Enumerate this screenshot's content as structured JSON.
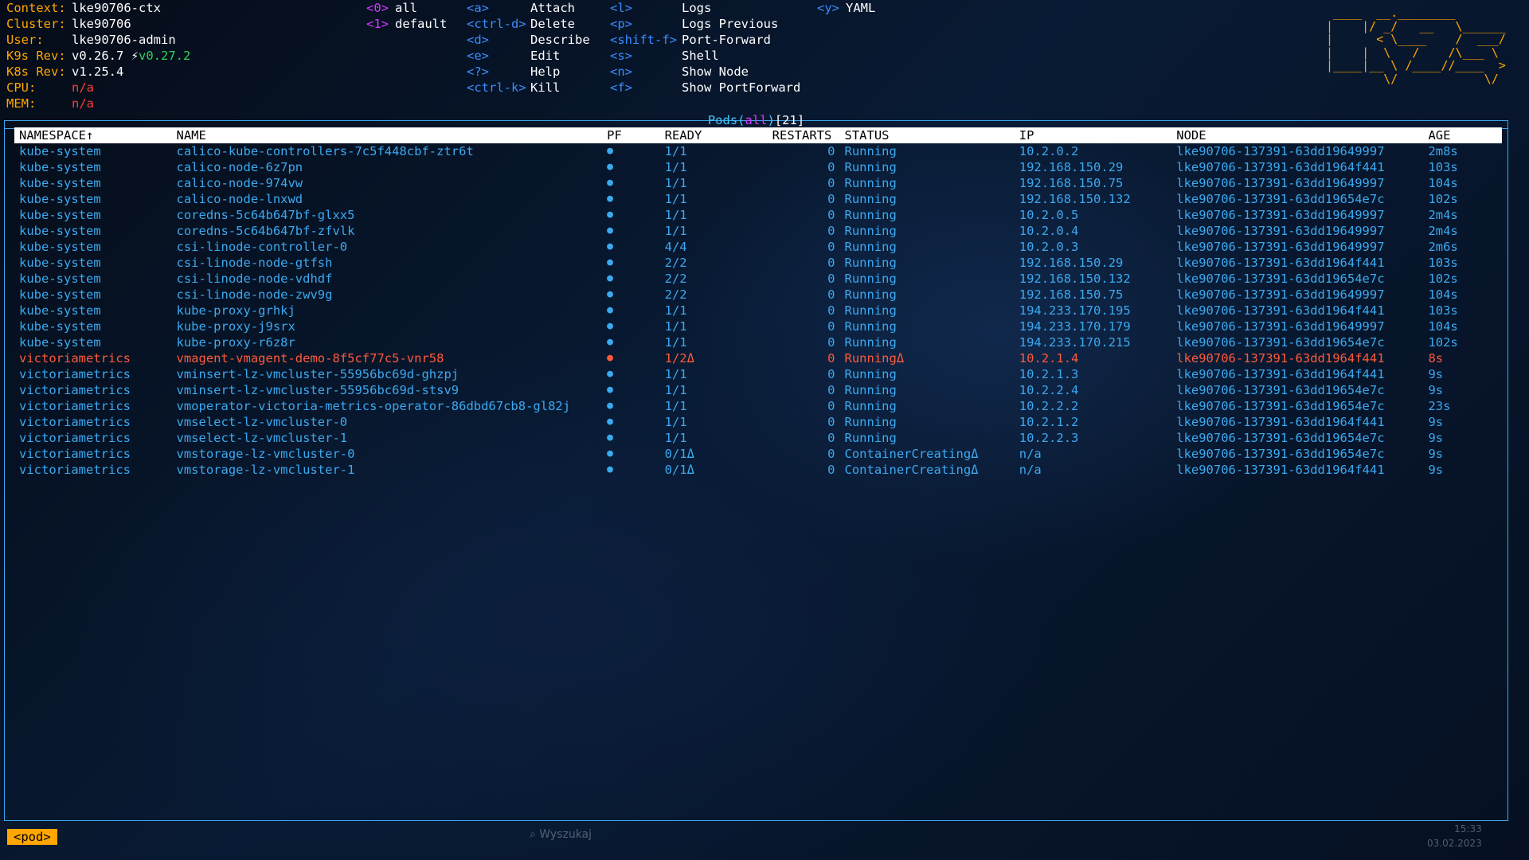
{
  "context_info": [
    {
      "label": "Context:",
      "value": "lke90706-ctx"
    },
    {
      "label": "Cluster:",
      "value": "lke90706"
    },
    {
      "label": "User:",
      "value": "lke90706-admin"
    },
    {
      "label": "K9s Rev:",
      "value": "v0.26.7",
      "update": "v0.27.2"
    },
    {
      "label": "K8s Rev:",
      "value": "v1.25.4"
    },
    {
      "label": "CPU:",
      "value": "n/a"
    },
    {
      "label": "MEM:",
      "value": "n/a"
    }
  ],
  "namespaces": [
    {
      "key": "<0>",
      "name": "all"
    },
    {
      "key": "<1>",
      "name": "default"
    }
  ],
  "hotkeys_col1": [
    {
      "key": "<a>",
      "desc": "Attach"
    },
    {
      "key": "<ctrl-d>",
      "desc": "Delete"
    },
    {
      "key": "<d>",
      "desc": "Describe"
    },
    {
      "key": "<e>",
      "desc": "Edit"
    },
    {
      "key": "<?>",
      "desc": "Help"
    },
    {
      "key": "<ctrl-k>",
      "desc": "Kill"
    }
  ],
  "hotkeys_col2": [
    {
      "key": "<l>",
      "desc": "Logs"
    },
    {
      "key": "<p>",
      "desc": "Logs Previous"
    },
    {
      "key": "<shift-f>",
      "desc": "Port-Forward"
    },
    {
      "key": "<s>",
      "desc": "Shell"
    },
    {
      "key": "<n>",
      "desc": "Show Node"
    },
    {
      "key": "<f>",
      "desc": "Show PortForward"
    }
  ],
  "hotkeys_col3": [
    {
      "key": "<y>",
      "desc": "YAML"
    }
  ],
  "logo_lines": [
    " ____  __.________       ",
    "|    |/ _/   __   \\______",
    "|      < \\____    /  ___/",
    "|    |  \\   /    /\\___ \\ ",
    "|____|__ \\ /____//____  >",
    "        \\/            \\/ "
  ],
  "frame": {
    "title": "Pods",
    "filter": "all",
    "count": "[21]"
  },
  "columns": [
    "NAMESPACE↑",
    "NAME",
    "PF",
    "READY",
    "RESTARTS",
    "STATUS",
    "IP",
    "NODE",
    "AGE"
  ],
  "pods": [
    {
      "state": "ok",
      "namespace": "kube-system",
      "name": "calico-kube-controllers-7c5f448cbf-ztr6t",
      "pf": "●",
      "ready": "1/1",
      "restarts": "0",
      "status": "Running",
      "ip": "10.2.0.2",
      "node": "lke90706-137391-63dd19649997",
      "age": "2m8s"
    },
    {
      "state": "ok",
      "namespace": "kube-system",
      "name": "calico-node-6z7pn",
      "pf": "●",
      "ready": "1/1",
      "restarts": "0",
      "status": "Running",
      "ip": "192.168.150.29",
      "node": "lke90706-137391-63dd1964f441",
      "age": "103s"
    },
    {
      "state": "ok",
      "namespace": "kube-system",
      "name": "calico-node-974vw",
      "pf": "●",
      "ready": "1/1",
      "restarts": "0",
      "status": "Running",
      "ip": "192.168.150.75",
      "node": "lke90706-137391-63dd19649997",
      "age": "104s"
    },
    {
      "state": "ok",
      "namespace": "kube-system",
      "name": "calico-node-lnxwd",
      "pf": "●",
      "ready": "1/1",
      "restarts": "0",
      "status": "Running",
      "ip": "192.168.150.132",
      "node": "lke90706-137391-63dd19654e7c",
      "age": "102s"
    },
    {
      "state": "ok",
      "namespace": "kube-system",
      "name": "coredns-5c64b647bf-glxx5",
      "pf": "●",
      "ready": "1/1",
      "restarts": "0",
      "status": "Running",
      "ip": "10.2.0.5",
      "node": "lke90706-137391-63dd19649997",
      "age": "2m4s"
    },
    {
      "state": "ok",
      "namespace": "kube-system",
      "name": "coredns-5c64b647bf-zfvlk",
      "pf": "●",
      "ready": "1/1",
      "restarts": "0",
      "status": "Running",
      "ip": "10.2.0.4",
      "node": "lke90706-137391-63dd19649997",
      "age": "2m4s"
    },
    {
      "state": "ok",
      "namespace": "kube-system",
      "name": "csi-linode-controller-0",
      "pf": "●",
      "ready": "4/4",
      "restarts": "0",
      "status": "Running",
      "ip": "10.2.0.3",
      "node": "lke90706-137391-63dd19649997",
      "age": "2m6s"
    },
    {
      "state": "ok",
      "namespace": "kube-system",
      "name": "csi-linode-node-gtfsh",
      "pf": "●",
      "ready": "2/2",
      "restarts": "0",
      "status": "Running",
      "ip": "192.168.150.29",
      "node": "lke90706-137391-63dd1964f441",
      "age": "103s"
    },
    {
      "state": "ok",
      "namespace": "kube-system",
      "name": "csi-linode-node-vdhdf",
      "pf": "●",
      "ready": "2/2",
      "restarts": "0",
      "status": "Running",
      "ip": "192.168.150.132",
      "node": "lke90706-137391-63dd19654e7c",
      "age": "102s"
    },
    {
      "state": "ok",
      "namespace": "kube-system",
      "name": "csi-linode-node-zwv9g",
      "pf": "●",
      "ready": "2/2",
      "restarts": "0",
      "status": "Running",
      "ip": "192.168.150.75",
      "node": "lke90706-137391-63dd19649997",
      "age": "104s"
    },
    {
      "state": "ok",
      "namespace": "kube-system",
      "name": "kube-proxy-grhkj",
      "pf": "●",
      "ready": "1/1",
      "restarts": "0",
      "status": "Running",
      "ip": "194.233.170.195",
      "node": "lke90706-137391-63dd1964f441",
      "age": "103s"
    },
    {
      "state": "ok",
      "namespace": "kube-system",
      "name": "kube-proxy-j9srx",
      "pf": "●",
      "ready": "1/1",
      "restarts": "0",
      "status": "Running",
      "ip": "194.233.170.179",
      "node": "lke90706-137391-63dd19649997",
      "age": "104s"
    },
    {
      "state": "ok",
      "namespace": "kube-system",
      "name": "kube-proxy-r6z8r",
      "pf": "●",
      "ready": "1/1",
      "restarts": "0",
      "status": "Running",
      "ip": "194.233.170.215",
      "node": "lke90706-137391-63dd19654e7c",
      "age": "102s"
    },
    {
      "state": "err",
      "namespace": "victoriametrics",
      "name": "vmagent-vmagent-demo-8f5cf77c5-vnr58",
      "pf": "●",
      "ready": "1/2Δ",
      "restarts": "0",
      "status": "RunningΔ",
      "ip": "10.2.1.4",
      "node": "lke90706-137391-63dd1964f441",
      "age": "8s"
    },
    {
      "state": "ok",
      "namespace": "victoriametrics",
      "name": "vminsert-lz-vmcluster-55956bc69d-ghzpj",
      "pf": "●",
      "ready": "1/1",
      "restarts": "0",
      "status": "Running",
      "ip": "10.2.1.3",
      "node": "lke90706-137391-63dd1964f441",
      "age": "9s"
    },
    {
      "state": "ok",
      "namespace": "victoriametrics",
      "name": "vminsert-lz-vmcluster-55956bc69d-stsv9",
      "pf": "●",
      "ready": "1/1",
      "restarts": "0",
      "status": "Running",
      "ip": "10.2.2.4",
      "node": "lke90706-137391-63dd19654e7c",
      "age": "9s"
    },
    {
      "state": "ok",
      "namespace": "victoriametrics",
      "name": "vmoperator-victoria-metrics-operator-86dbd67cb8-gl82j",
      "pf": "●",
      "ready": "1/1",
      "restarts": "0",
      "status": "Running",
      "ip": "10.2.2.2",
      "node": "lke90706-137391-63dd19654e7c",
      "age": "23s"
    },
    {
      "state": "ok",
      "namespace": "victoriametrics",
      "name": "vmselect-lz-vmcluster-0",
      "pf": "●",
      "ready": "1/1",
      "restarts": "0",
      "status": "Running",
      "ip": "10.2.1.2",
      "node": "lke90706-137391-63dd1964f441",
      "age": "9s"
    },
    {
      "state": "ok",
      "namespace": "victoriametrics",
      "name": "vmselect-lz-vmcluster-1",
      "pf": "●",
      "ready": "1/1",
      "restarts": "0",
      "status": "Running",
      "ip": "10.2.2.3",
      "node": "lke90706-137391-63dd19654e7c",
      "age": "9s"
    },
    {
      "state": "pend",
      "namespace": "victoriametrics",
      "name": "vmstorage-lz-vmcluster-0",
      "pf": "●",
      "ready": "0/1Δ",
      "restarts": "0",
      "status": "ContainerCreatingΔ",
      "ip": "n/a",
      "node": "lke90706-137391-63dd19654e7c",
      "age": "9s"
    },
    {
      "state": "pend",
      "namespace": "victoriametrics",
      "name": "vmstorage-lz-vmcluster-1",
      "pf": "●",
      "ready": "0/1Δ",
      "restarts": "0",
      "status": "ContainerCreatingΔ",
      "ip": "n/a",
      "node": "lke90706-137391-63dd1964f441",
      "age": "9s"
    }
  ],
  "breadcrumb": "<pod>",
  "taskbar": {
    "search": "Wyszukaj",
    "time": "15:33",
    "date": "03.02.2023"
  },
  "colors": {
    "accent": "#3ba9f0",
    "header_label": "#ffa600",
    "hotkey_ns": "#d63aff",
    "error": "#ff5a3a"
  }
}
